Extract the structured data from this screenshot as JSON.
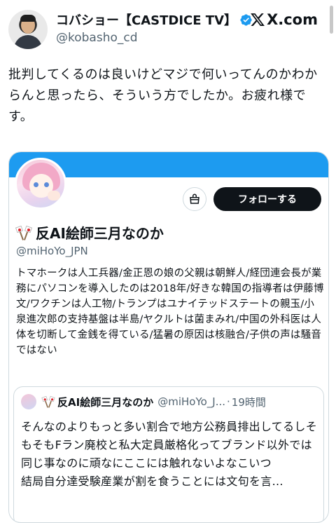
{
  "author": {
    "display_name": "コバショー【CASTDICE TV】",
    "handle": "@kobasho_cd",
    "verified": true,
    "avatar_icon": "user-avatar"
  },
  "source_badge": {
    "label": "X.com",
    "icon": "x-logo-icon"
  },
  "tweet": {
    "text": "批判してくるのは良いけどマジで何いってんのかわからんと思ったら、そういう方でしたか。お疲れ様です。"
  },
  "profile_card": {
    "banner_color": "#1d9bf0",
    "shop_icon": "shop-icon",
    "follow_label": "フォローする",
    "name": "反AI絵師三月なのか",
    "handle": "@miHoYo_JPN",
    "bio": "トマホークは人工兵器/金正恩の娘の父親は朝鮮人/経団連会長が業務にパソコンを導入したのは2018年/好きな韓国の指導者は伊藤博文/ワクチンは人工物/トランプはユナイテッドステートの親玉/小泉進次郎の支持基盤は半島/ヤクルトは菌まみれ/中国の外科医は人体を切断して金銭を得ている/猛暑の原因は核融合/子供の声は騒音ではない"
  },
  "quoted_post": {
    "name": "反AI絵師三月なのか",
    "handle": "@miHoYo_J...",
    "separator": "·",
    "time": "19時間",
    "text": "そんなのよりもっと多い割合で地方公務員排出してるしそもそもFラン廃校と私大定員厳格化ってブランド以外では同じ事なのに頑なにここには触れないよなこいつ\n結局自分達受験産業が割を食うことには文句を言..."
  },
  "colors": {
    "accent": "#1d9bf0",
    "text": "#0f1419",
    "secondary_text": "#536471",
    "border": "#cfd9de"
  }
}
